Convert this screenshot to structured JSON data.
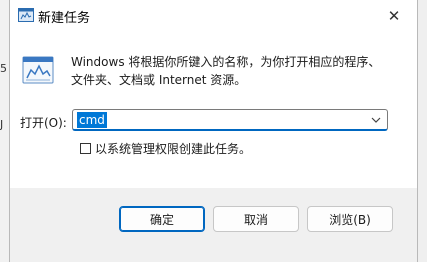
{
  "background": {
    "fragment1": "5",
    "fragment2": "J"
  },
  "window": {
    "title": "新建任务",
    "close_glyph": "✕"
  },
  "content": {
    "description": "Windows 将根据你所键入的名称，为你打开相应的程序、文件夹、文档或 Internet 资源。",
    "open_label": "打开(O):",
    "command_value": "cmd",
    "admin_checkbox_label": "以系统管理权限创建此任务。",
    "admin_checked": false
  },
  "buttons": {
    "ok": "确定",
    "cancel": "取消",
    "browse": "浏览(B)"
  },
  "colors": {
    "accent": "#0067c0",
    "selection": "#0078d7"
  },
  "icons": [
    "run-dialog-icon",
    "combo-dropdown-icon",
    "close-icon"
  ]
}
